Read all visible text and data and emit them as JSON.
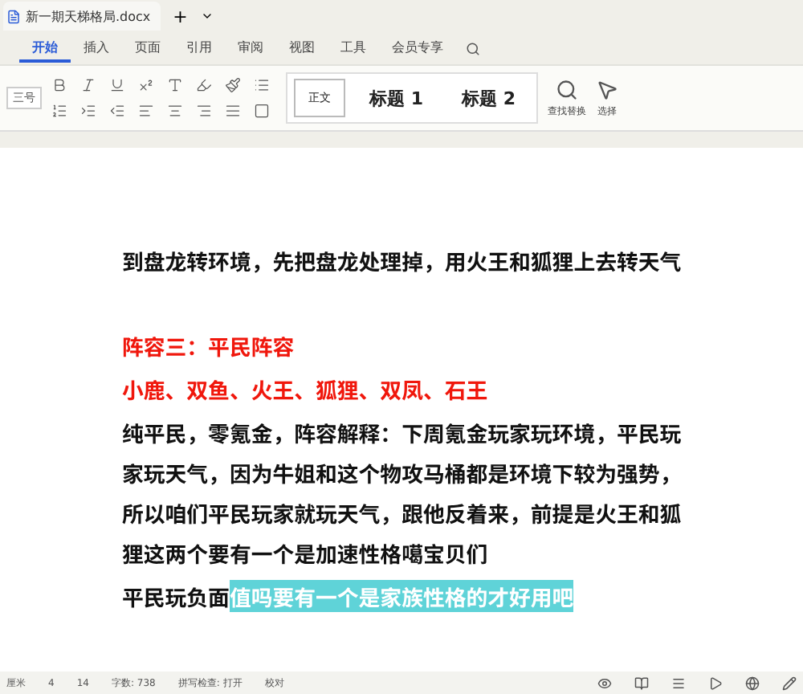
{
  "window": {
    "tab_title": "新一期天梯格局.docx",
    "new_tab": "+"
  },
  "tabs": [
    {
      "label": "开始",
      "selected": true
    },
    {
      "label": "插入",
      "selected": false
    },
    {
      "label": "页面",
      "selected": false
    },
    {
      "label": "引用",
      "selected": false
    },
    {
      "label": "审阅",
      "selected": false
    },
    {
      "label": "视图",
      "selected": false
    },
    {
      "label": "工具",
      "selected": false
    },
    {
      "label": "会员专享",
      "selected": false
    }
  ],
  "toolbar": {
    "font_size": "三号",
    "styles": [
      {
        "label": "正文",
        "selected": true
      },
      {
        "label": "标题 1",
        "selected": false
      },
      {
        "label": "标题 2",
        "selected": false
      }
    ],
    "find_replace": "查找替换",
    "select": "选择"
  },
  "document": {
    "paragraphs": [
      {
        "kind": "black",
        "text": "到盘龙转环境，先把盘龙处理掉，用火王和狐狸上去转天气"
      },
      {
        "kind": "gap"
      },
      {
        "kind": "red",
        "text": "阵容三：平民阵容"
      },
      {
        "kind": "red",
        "text": "小鹿、双鱼、火王、狐狸、双凤、石王"
      },
      {
        "kind": "black",
        "text": "纯平民，零氪金，阵容解释：下周氪金玩家玩环境，平民玩家玩天气，因为牛姐和这个物攻马桶都是环境下较为强势，所以咱们平民玩家就玩天气，跟他反着来，前提是火王和狐狸这两个要有一个是加速性格噶宝贝们"
      },
      {
        "kind": "black",
        "text": "平民玩负面",
        "caption": "值吗要有一个是家族性格的才好用吧"
      }
    ]
  },
  "status_bar": {
    "items": [
      "厘米",
      "4",
      "14",
      "字数: 738",
      "拼写检查: 打开",
      "校对"
    ]
  }
}
